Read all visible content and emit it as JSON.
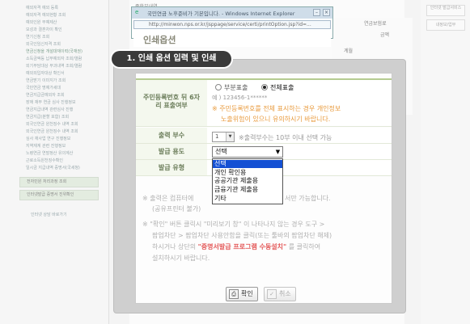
{
  "background": {
    "breadcrumb": "종합부내역",
    "left_menu": [
      "예외자격 예외 등록",
      "예외자격 예외현황 조회",
      "예외인원 무예제산",
      "모성과 결혼차이 확인",
      "연기신청 조회",
      "외국인임신자격 조회",
      "연금신청을 개설대재이력(국재권)",
      "소득금액등 납부예외자 조회/열람",
      "외기부담대상 부과내역 조회/열람",
      "예외외입자대상 확인서",
      "연금받기 이미지가 조회",
      "국민연금 명예가세대",
      "연금지급금예외자 조회",
      "장애 재무 연금 심사 진행정보",
      "연금지급내역 관련심사 진행",
      "연금지급(분할 포함) 조회",
      "외국인연금 원천징수 내역 조회",
      "외국인연금 원천징수 내역 조회",
      "심사 재사업 연구 진행정보",
      "지역재계 관련 진행정보",
      "노령연금 연말정산 유의계산",
      "근로소득원천징수확인",
      "일시금 지급내역 증명서(국세청)"
    ],
    "side_boxes": [
      "전자민원 처리과정 조회",
      "인터넷발급 증명서 진위확인"
    ],
    "side_link": "인터넷 상담 바로가기",
    "right_buttons": [
      "인터넷 발급서비스",
      "내정보/업무"
    ],
    "table_header": "연금보험료",
    "table_sub": "금액",
    "table_row": "계월"
  },
  "popup_window": {
    "title": "국민연금 노후준비가 기본입니다. - Windows Internet Explorer",
    "address": "http://minwon.nps.or.kr/jsppage/service/certi/printOption.jsp?id=...",
    "heading": "인쇄옵션"
  },
  "step_label": "1. 인쇄 옵션 입력 및 인쇄",
  "form": {
    "rrn_label": "주민등록번호 뒤 6자리 표출여부",
    "radio_partial": "부분표출",
    "radio_full": "전체표출",
    "example": "예 ) 123456-1******",
    "warning_line1": "※ 주민등록번호를 전체 표시하는 경우 개인정보",
    "warning_line2": "노출위험이 있으니 유의하시기 바랍니다.",
    "copies_label": "출력 부수",
    "copies_value": "1",
    "copies_note": "※출력부수는 10부 이내 선택 가능",
    "purpose_label": "발급 용도",
    "purpose_value": "선택",
    "type_label": "발급 유형",
    "purpose_options": [
      "선택",
      "개인 확인용",
      "공공기관 제출용",
      "금융기관 제출용",
      "기타"
    ]
  },
  "notes": {
    "line1_pre": "※ 출력은 컴퓨터에",
    "line1_post": "서만 가능합니다.",
    "line2": "(공유프린터 불가)",
    "line3": "※ \"확인\" 버튼 클릭시 \"미리보기 창\" 이 나타나지 않는 경우 도구 >",
    "line4": "팝업차단 > 팝업차단 사용안함을 클릭(또는 툴바의 팝업차단 해제)",
    "line5_pre": "하시거나 상단의",
    "line5_red": "\"증명서발급 프로그램 수동설치\"",
    "line5_post": "를 클릭하여",
    "line6": "설치하시기 바랍니다."
  },
  "buttons": {
    "confirm": "확인",
    "cancel": "취소"
  },
  "colors": {
    "accent_green": "#b5cc91",
    "warning_orange": "#e89a3c",
    "selection_blue": "#1450d4",
    "notice_red": "#e45a5a"
  }
}
